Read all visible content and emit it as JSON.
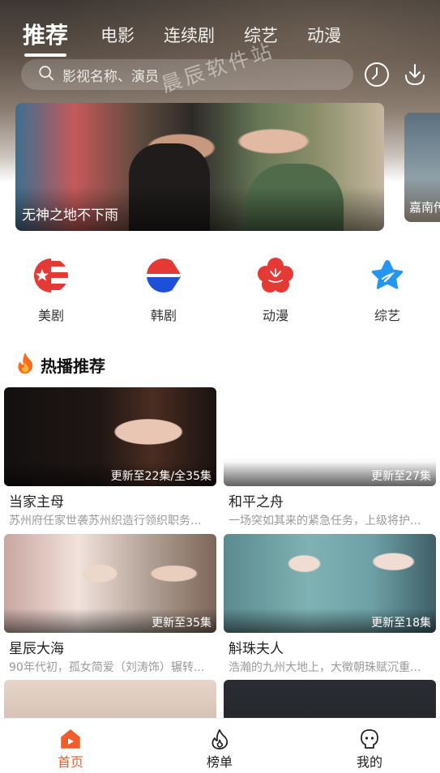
{
  "tabs": [
    {
      "label": "推荐",
      "active": true
    },
    {
      "label": "电影",
      "active": false
    },
    {
      "label": "连续剧",
      "active": false
    },
    {
      "label": "综艺",
      "active": false
    },
    {
      "label": "动漫",
      "active": false
    }
  ],
  "search": {
    "placeholder": "影视名称、演员"
  },
  "header_icons": [
    "history-clock-icon",
    "download-icon"
  ],
  "watermark": "晨辰软件站",
  "banner": {
    "title": "无神之地不下雨",
    "next_title": "嘉南传"
  },
  "categories": [
    {
      "label": "美剧",
      "icon": "us-flag-icon"
    },
    {
      "label": "韩剧",
      "icon": "korea-play-icon"
    },
    {
      "label": "动漫",
      "icon": "flower-icon"
    },
    {
      "label": "综艺",
      "icon": "star-icon"
    }
  ],
  "section": {
    "title": "热播推荐",
    "icon": "fire-icon"
  },
  "items": [
    {
      "title": "当家主母",
      "desc": "苏州府任家世袭苏州织造行领织职务...",
      "badge": "更新至22集/全35集"
    },
    {
      "title": "和平之舟",
      "desc": "一场突如其来的紧急任务，上级将护...",
      "badge": "更新至27集"
    },
    {
      "title": "星辰大海",
      "desc": "90年代初，孤女简爱（刘涛饰）辗转...",
      "badge": "更新至35集"
    },
    {
      "title": "斛珠夫人",
      "desc": "浩瀚的九州大地上，大徵朝珠赋沉重...",
      "badge": "更新至18集"
    }
  ],
  "nav": [
    {
      "label": "首页",
      "icon": "home-icon",
      "active": true
    },
    {
      "label": "榜单",
      "icon": "ranking-flame-icon",
      "active": false
    },
    {
      "label": "我的",
      "icon": "profile-icon",
      "active": false
    }
  ],
  "colors": {
    "accent": "#f05c2c",
    "us_red": "#e53935",
    "korea_blue": "#1e4fd8",
    "star_blue": "#2196f3"
  }
}
